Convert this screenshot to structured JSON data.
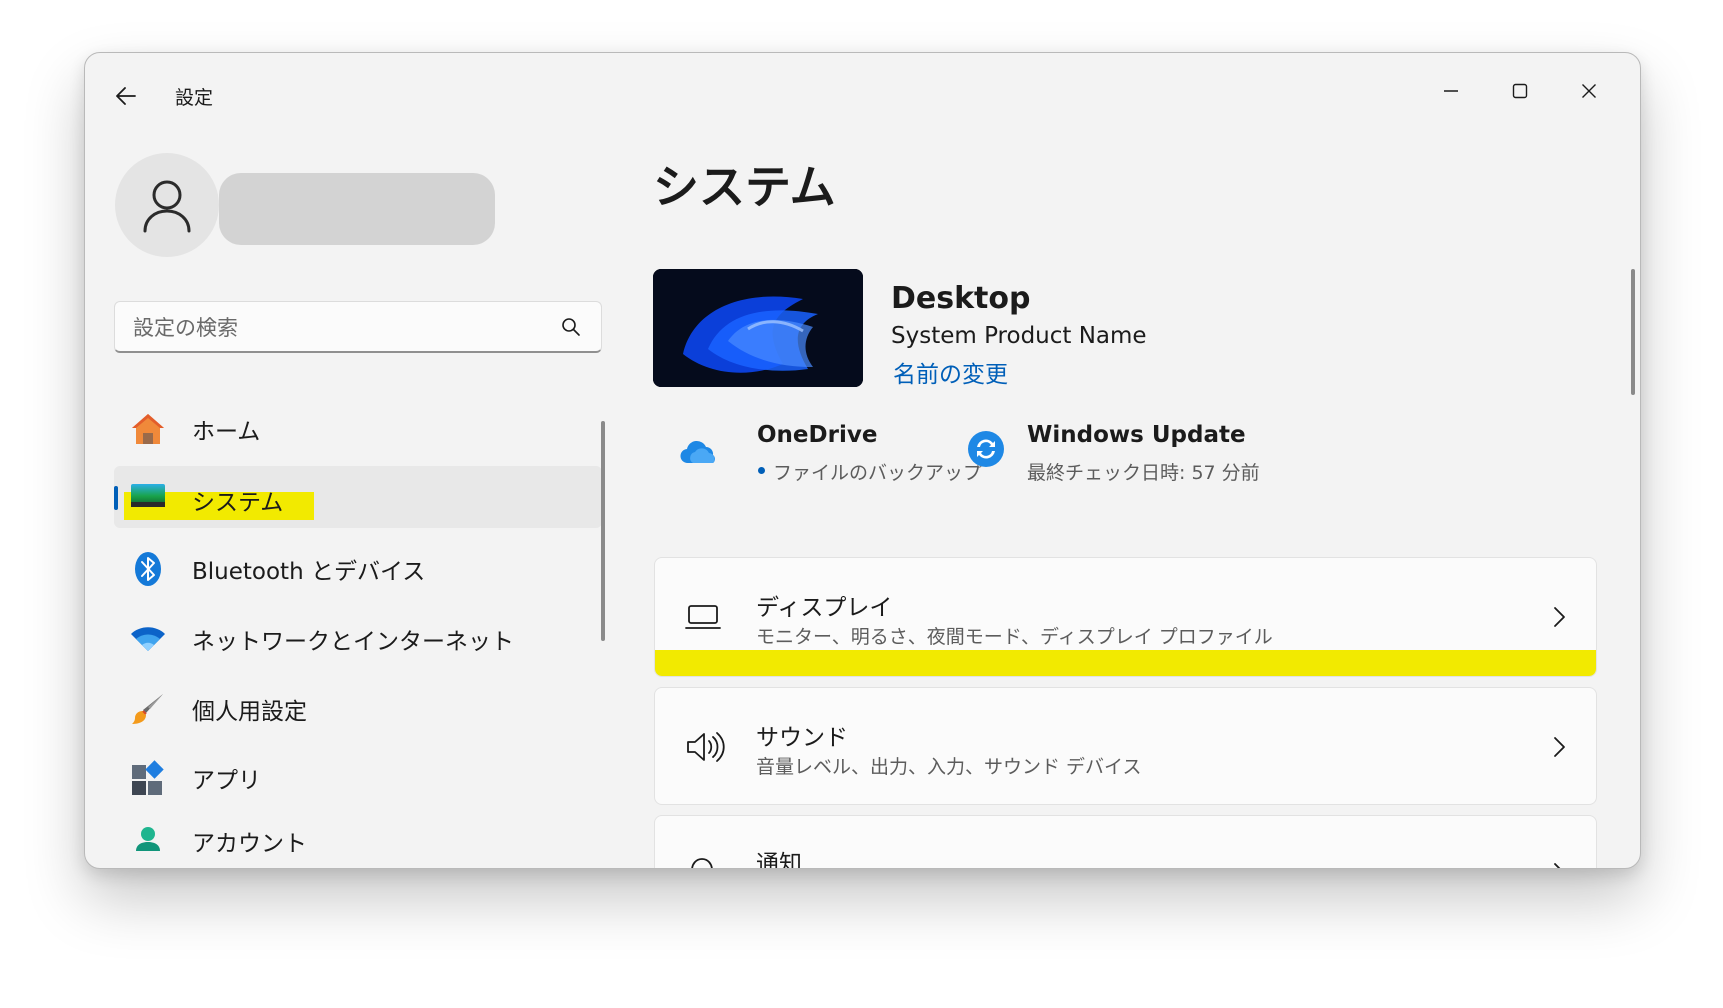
{
  "window": {
    "title": "設定",
    "controls": [
      "minimize",
      "maximize",
      "close"
    ]
  },
  "user": {
    "avatar_icon": "person-icon"
  },
  "search": {
    "placeholder": "設定の検索",
    "icon": "search-icon"
  },
  "sidebar": {
    "items": [
      {
        "label": "ホーム",
        "icon": "home-icon",
        "selected": false
      },
      {
        "label": "システム",
        "icon": "system-icon",
        "selected": true
      },
      {
        "label": "Bluetooth とデバイス",
        "icon": "bluetooth-icon",
        "selected": false
      },
      {
        "label": "ネットワークとインターネット",
        "icon": "wifi-icon",
        "selected": false
      },
      {
        "label": "個人用設定",
        "icon": "brush-icon",
        "selected": false
      },
      {
        "label": "アプリ",
        "icon": "apps-icon",
        "selected": false
      },
      {
        "label": "アカウント",
        "icon": "account-icon",
        "selected": false
      }
    ]
  },
  "main": {
    "title": "システム",
    "device": {
      "name": "Desktop",
      "model": "System Product Name",
      "rename_label": "名前の変更"
    },
    "tiles": {
      "onedrive": {
        "title": "OneDrive",
        "subtitle": "ファイルのバックアップ"
      },
      "windows_update": {
        "title": "Windows Update",
        "subtitle": "最終チェック日時: 57 分前"
      }
    },
    "cards": [
      {
        "title": "ディスプレイ",
        "subtitle": "モニター、明るさ、夜間モード、ディスプレイ プロファイル",
        "icon": "display-icon"
      },
      {
        "title": "サウンド",
        "subtitle": "音量レベル、出力、入力、サウンド デバイス",
        "icon": "speaker-icon"
      },
      {
        "title": "通知",
        "subtitle": "",
        "icon": "bell-icon"
      }
    ]
  },
  "colors": {
    "accent": "#005fb8",
    "highlight": "#f2ea00",
    "window_bg": "#f3f3f3",
    "card_bg": "#fbfbfb"
  }
}
